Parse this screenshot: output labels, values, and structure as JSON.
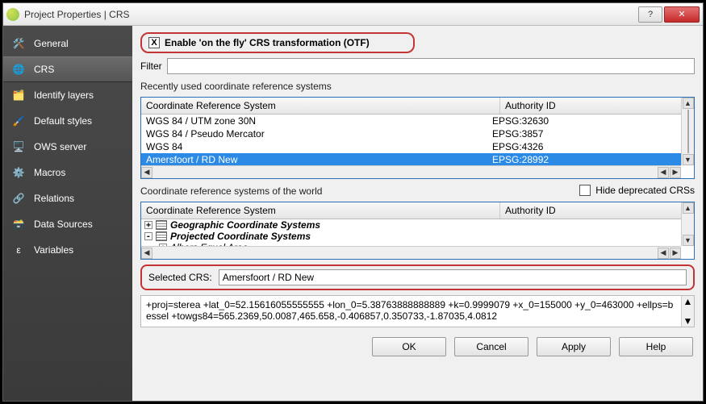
{
  "window": {
    "title": "Project Properties | CRS"
  },
  "sidebar": {
    "items": [
      {
        "label": "General"
      },
      {
        "label": "CRS"
      },
      {
        "label": "Identify layers"
      },
      {
        "label": "Default styles"
      },
      {
        "label": "OWS server"
      },
      {
        "label": "Macros"
      },
      {
        "label": "Relations"
      },
      {
        "label": "Data Sources"
      },
      {
        "label": "Variables"
      }
    ]
  },
  "otf": {
    "label": "Enable 'on the fly' CRS transformation (OTF)",
    "checked": "X"
  },
  "filter": {
    "label": "Filter",
    "value": ""
  },
  "recent": {
    "label": "Recently used coordinate reference systems",
    "headers": {
      "crs": "Coordinate Reference System",
      "auth": "Authority ID"
    },
    "rows": [
      {
        "crs": "WGS 84 / UTM zone 30N",
        "auth": "EPSG:32630"
      },
      {
        "crs": "WGS 84 / Pseudo Mercator",
        "auth": "EPSG:3857"
      },
      {
        "crs": "WGS 84",
        "auth": "EPSG:4326"
      },
      {
        "crs": "Amersfoort / RD New",
        "auth": "EPSG:28992"
      }
    ],
    "selected_index": 3
  },
  "world": {
    "label": "Coordinate reference systems of the world",
    "hide_deprecated_label": "Hide deprecated CRSs",
    "headers": {
      "crs": "Coordinate Reference System",
      "auth": "Authority ID"
    },
    "tree": [
      {
        "label": "Geographic Coordinate Systems",
        "bold": true,
        "level": 0,
        "exp": "+"
      },
      {
        "label": "Projected Coordinate Systems",
        "bold": true,
        "level": 0,
        "exp": "-"
      },
      {
        "label": "Albers Equal Area",
        "bold": false,
        "level": 1,
        "exp": "+"
      }
    ]
  },
  "selected": {
    "label": "Selected CRS:",
    "value": "Amersfoort / RD New"
  },
  "proj4": "+proj=sterea +lat_0=52.15616055555555 +lon_0=5.38763888888889 +k=0.9999079 +x_0=155000 +y_0=463000 +ellps=bessel +towgs84=565.2369,50.0087,465.658,-0.406857,0.350733,-1.87035,4.0812",
  "buttons": {
    "ok": "OK",
    "cancel": "Cancel",
    "apply": "Apply",
    "help": "Help"
  }
}
